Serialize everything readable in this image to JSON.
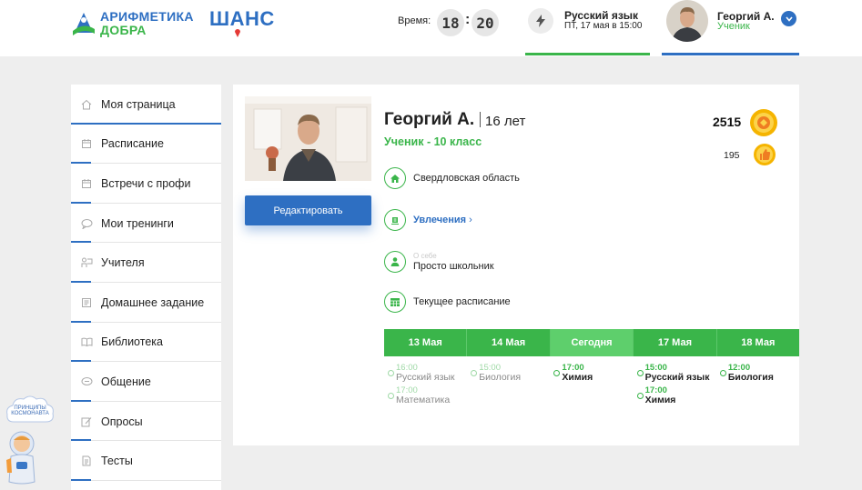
{
  "header": {
    "logo1": {
      "line1": "АРИФМЕТИКА",
      "line2": "ДОБРА"
    },
    "logo2": {
      "text": "ШАНС"
    },
    "time": {
      "label": "Время:",
      "hours": "18",
      "minutes": "20"
    },
    "next_lesson": {
      "subject": "Русский язык",
      "when": "ПТ, 17 мая в 15:00",
      "icon": "lightning-icon"
    },
    "user": {
      "name": "Георгий А.",
      "role": "Ученик"
    }
  },
  "sidebar": {
    "items": [
      {
        "label": "Моя страница",
        "icon": "home-icon",
        "active": true
      },
      {
        "label": "Расписание",
        "icon": "calendar-icon"
      },
      {
        "label": "Встречи с профи",
        "icon": "calendar-icon"
      },
      {
        "label": "Мои тренинги",
        "icon": "speech-bubble-icon"
      },
      {
        "label": "Учителя",
        "icon": "teacher-icon"
      },
      {
        "label": "Домашнее задание",
        "icon": "homework-icon"
      },
      {
        "label": "Библиотека",
        "icon": "book-icon"
      },
      {
        "label": "Общение",
        "icon": "chat-icon"
      },
      {
        "label": "Опросы",
        "icon": "pencil-icon"
      },
      {
        "label": "Тесты",
        "icon": "document-icon"
      }
    ]
  },
  "profile": {
    "name": "Георгий А.",
    "age": "16 лет",
    "grade": "Ученик - 10 класс",
    "edit_label": "Редактировать",
    "score_main": "2515",
    "score_secondary": "195",
    "region": "Свердловская область",
    "hobbies_label": "Увлечения",
    "about_caption": "О себе",
    "about_text": "Просто школьник",
    "schedule_label": "Текущее расписание"
  },
  "schedule": {
    "days": [
      "13 Мая",
      "14 Мая",
      "Сегодня",
      "17 Мая",
      "18 Мая"
    ],
    "columns": [
      [
        {
          "time": "16:00",
          "subject": "Русский язык",
          "past": true
        },
        {
          "time": "17:00",
          "subject": "Математика",
          "past": true
        }
      ],
      [
        {
          "time": "15:00",
          "subject": "Биология",
          "past": true
        }
      ],
      [
        {
          "time": "17:00",
          "subject": "Химия",
          "past": false
        }
      ],
      [
        {
          "time": "15:00",
          "subject": "Русский язык",
          "past": false
        },
        {
          "time": "17:00",
          "subject": "Химия",
          "past": false
        }
      ],
      [
        {
          "time": "12:00",
          "subject": "Биология",
          "past": false
        }
      ]
    ]
  },
  "mascot": {
    "cloud_text": "ПРИНЦИПЫ КОСМОНАВТА"
  },
  "colors": {
    "blue": "#2e6fc2",
    "green": "#3ab54a",
    "gold": "#f5b400"
  }
}
